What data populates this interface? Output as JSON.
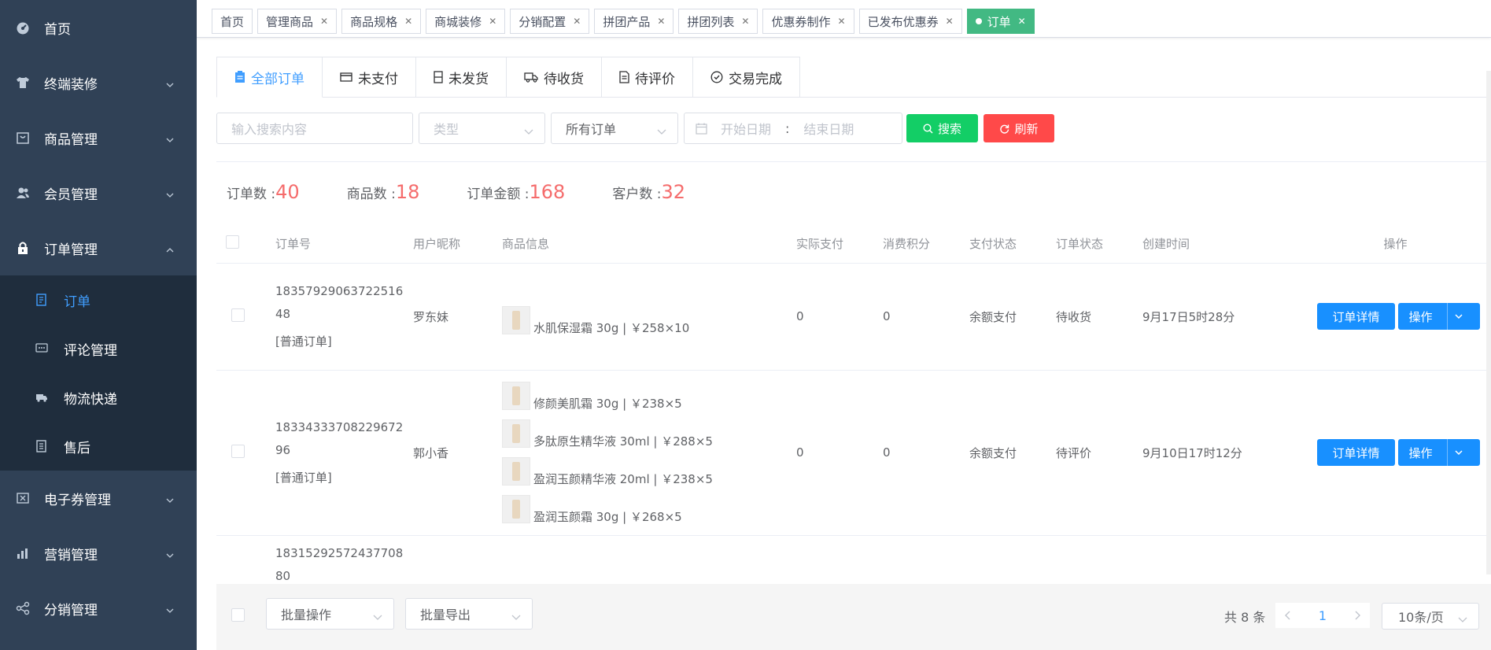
{
  "sidebar": {
    "items": [
      {
        "label": "首页",
        "icon": "dashboard-icon",
        "arrow": false
      },
      {
        "label": "终端装修",
        "icon": "shirt-icon",
        "arrow": true
      },
      {
        "label": "商品管理",
        "icon": "bag-icon",
        "arrow": true
      },
      {
        "label": "会员管理",
        "icon": "users-icon",
        "arrow": true
      },
      {
        "label": "订单管理",
        "icon": "lock-icon",
        "arrow": true,
        "open": true
      }
    ],
    "subitems": [
      {
        "label": "订单",
        "icon": "document-icon",
        "active": true
      },
      {
        "label": "评论管理",
        "icon": "comment-icon"
      },
      {
        "label": "物流快递",
        "icon": "truck-icon"
      },
      {
        "label": "售后",
        "icon": "receipt-icon"
      }
    ],
    "items_after": [
      {
        "label": "电子券管理",
        "icon": "coupon-icon"
      },
      {
        "label": "营销管理",
        "icon": "chart-icon"
      },
      {
        "label": "分销管理",
        "icon": "share-icon"
      }
    ]
  },
  "tags": [
    {
      "label": "首页",
      "closable": false
    },
    {
      "label": "管理商品",
      "closable": true
    },
    {
      "label": "商品规格",
      "closable": true
    },
    {
      "label": "商城装修",
      "closable": true
    },
    {
      "label": "分销配置",
      "closable": true
    },
    {
      "label": "拼团产品",
      "closable": true
    },
    {
      "label": "拼团列表",
      "closable": true
    },
    {
      "label": "优惠券制作",
      "closable": true
    },
    {
      "label": "已发布优惠券",
      "closable": true
    },
    {
      "label": "订单",
      "closable": true,
      "active": true
    }
  ],
  "tabs": [
    {
      "label": "全部订单",
      "icon": "clipboard-icon"
    },
    {
      "label": "未支付",
      "icon": "card-icon"
    },
    {
      "label": "未发货",
      "icon": "box-icon"
    },
    {
      "label": "待收货",
      "icon": "truck-icon"
    },
    {
      "label": "待评价",
      "icon": "doc-icon"
    },
    {
      "label": "交易完成",
      "icon": "check-circle-icon"
    }
  ],
  "filters": {
    "search_placeholder": "输入搜索内容",
    "type_placeholder": "类型",
    "order_select": "所有订单",
    "start_date": "开始日期",
    "date_sep": ":",
    "end_date": "结束日期",
    "search_btn": "搜索",
    "refresh_btn": "刷新"
  },
  "stats": {
    "orders_label": "订单数 :",
    "orders": "40",
    "goods_label": "商品数 :",
    "goods": "18",
    "amount_label": "订单金额 :",
    "amount": "168",
    "customers_label": "客户数 :",
    "customers": "32"
  },
  "table": {
    "headers": [
      "订单号",
      "用户昵称",
      "商品信息",
      "实际支付",
      "消费积分",
      "支付状态",
      "订单状态",
      "创建时间",
      "操作"
    ],
    "detail_btn": "订单详情",
    "op_btn": "操作",
    "rows": [
      {
        "order_no_1": "18357929063722516",
        "order_no_2": "48",
        "order_type": "[普通订单]",
        "user": "罗东妹",
        "goods": [
          "水肌保湿霜  30g | ￥258×10"
        ],
        "pay": "0",
        "points": "0",
        "pay_status": "余额支付",
        "order_status": "待收货",
        "time": "9月17日5时28分"
      },
      {
        "order_no_1": "18334333708229672",
        "order_no_2": "96",
        "order_type": "[普通订单]",
        "user": "郭小香",
        "goods": [
          "修颜美肌霜  30g | ￥238×5",
          "多肽原生精华液  30ml | ￥288×5",
          "盈润玉颜精华液  20ml | ￥238×5",
          "盈润玉颜霜  30g | ￥268×5"
        ],
        "pay": "0",
        "points": "0",
        "pay_status": "余额支付",
        "order_status": "待评价",
        "time": "9月10日17时12分"
      },
      {
        "order_no_1": "18315292572437708",
        "order_no_2": "80"
      }
    ]
  },
  "footer": {
    "batch_op": "批量操作",
    "batch_export": "批量导出",
    "total": "共 8 条",
    "page": "1",
    "page_size": "10条/页"
  },
  "colors": {
    "accent": "#409eff",
    "green": "#13ce66",
    "red": "#ff4949",
    "tag_active": "#42b983",
    "sidebar": "#304156"
  }
}
